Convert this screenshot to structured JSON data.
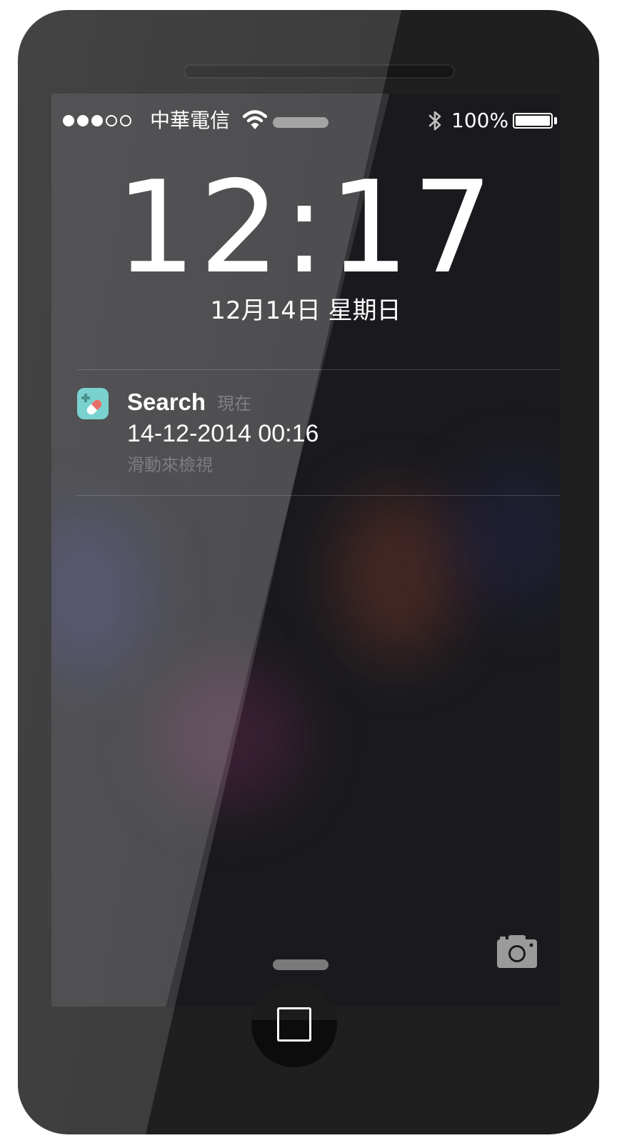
{
  "status_bar": {
    "signal_bars_filled": 3,
    "signal_bars_total": 5,
    "carrier": "中華電信",
    "battery_percent_label": "100%",
    "battery_level": 1.0,
    "icons": [
      "wifi-icon",
      "bluetooth-icon",
      "battery-icon"
    ]
  },
  "lock_screen": {
    "time": "12:17",
    "date": "12月14日 星期日"
  },
  "notification": {
    "app_icon": "pill-plus-icon",
    "title": "Search",
    "time": "現在",
    "body": "14-12-2014 00:16",
    "hint": "滑動來檢視"
  },
  "controls": {
    "camera_icon": "camera-icon",
    "home_button_icon": "home-square-icon"
  },
  "colors": {
    "app_icon_bg": "#4fc4c0",
    "screen_bg": "#1a1a1e",
    "phone_body": "#1f1f1f"
  }
}
